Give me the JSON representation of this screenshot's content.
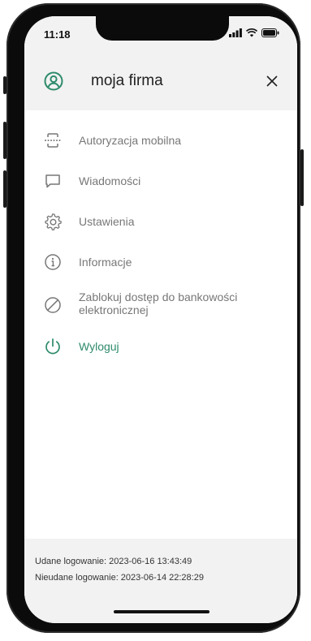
{
  "status_bar": {
    "time": "11:18",
    "icons": [
      "signal-icon",
      "wifi-icon",
      "battery-icon"
    ]
  },
  "header": {
    "icon": "user-icon",
    "title": "moja firma",
    "close_icon": "close-icon"
  },
  "menu": {
    "items": [
      {
        "label": "Autoryzacja mobilna",
        "icon": "mobile-authorization-icon"
      },
      {
        "label": "Wiadomości",
        "icon": "message-icon"
      },
      {
        "label": "Ustawienia",
        "icon": "gear-icon"
      },
      {
        "label": "Informacje",
        "icon": "info-icon"
      },
      {
        "label": "Zablokuj dostęp do bankowości elektronicznej",
        "icon": "block-icon"
      },
      {
        "label": "Wyloguj",
        "icon": "power-icon"
      }
    ]
  },
  "footer": {
    "successful_login": "Udane logowanie: 2023-06-16 13:43:49",
    "failed_login": "Nieudane logowanie: 2023-06-14 22:28:29"
  },
  "colors": {
    "accent": "#2e8b6a",
    "muted_text": "#777777",
    "header_bg": "#f2f2f2"
  }
}
